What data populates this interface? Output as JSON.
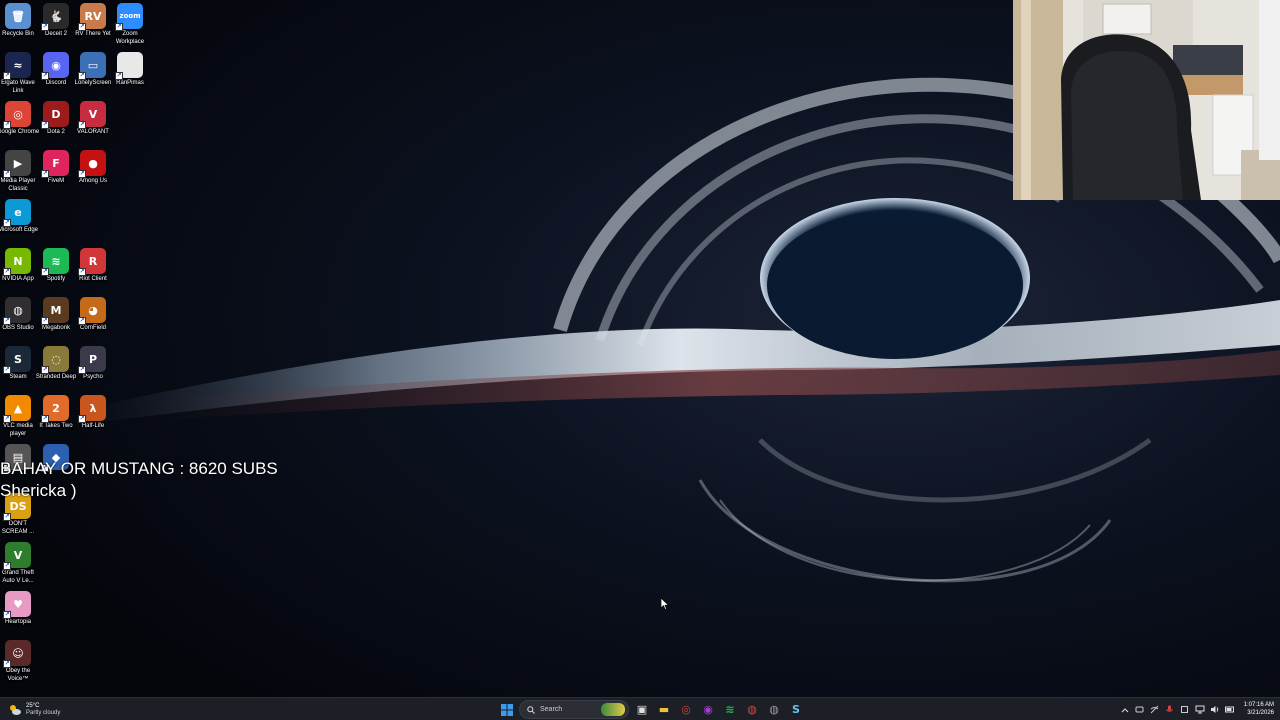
{
  "desktop": {
    "icons": [
      {
        "name": "recycle-bin-icon",
        "label": "Recycle Bin",
        "color": "#5a8fd0",
        "glyph": "🗑"
      },
      {
        "name": "deceit-2-icon",
        "label": "Deceit 2",
        "color": "#2a2a2a",
        "glyph": "🐇"
      },
      {
        "name": "rv-there-yet-icon",
        "label": "RV There Yet",
        "color": "#c97a4a",
        "glyph": "RV"
      },
      {
        "name": "zoom-icon",
        "label": "Zoom Workplace",
        "color": "#2d8cff",
        "glyph": "zoom"
      },
      {
        "name": "elgato-wave-link-icon",
        "label": "Elgato Wave Link",
        "color": "#1a2550",
        "glyph": "≈"
      },
      {
        "name": "discord-icon",
        "label": "Discord",
        "color": "#5865f2",
        "glyph": "◉"
      },
      {
        "name": "lonelyscreen-icon",
        "label": "LonelyScreen",
        "color": "#3b6fb6",
        "glyph": "▭"
      },
      {
        "name": "ranpimas-icon",
        "label": "RanPimas",
        "color": "#e8e8e8",
        "glyph": ""
      },
      {
        "name": "google-chrome-icon",
        "label": "Google Chrome",
        "color": "#db4437",
        "glyph": "◎"
      },
      {
        "name": "dota-2-icon",
        "label": "Dota 2",
        "color": "#9c1b1b",
        "glyph": "D"
      },
      {
        "name": "valorant-icon",
        "label": "VALORANT",
        "color": "#c72c41",
        "glyph": "V"
      },
      {
        "name": "media-player-classic-icon",
        "label": "Media Player Classic",
        "color": "#444",
        "glyph": "▶"
      },
      {
        "name": "fivem-icon",
        "label": "FiveM",
        "color": "#e0245e",
        "glyph": "F"
      },
      {
        "name": "among-us-icon",
        "label": "Among Us",
        "color": "#c51111",
        "glyph": "●"
      },
      {
        "name": "microsoft-edge-icon",
        "label": "Microsoft Edge",
        "color": "#0c9ad6",
        "glyph": "e"
      },
      {
        "name": "nvidia-app-icon",
        "label": "NVIDIA App",
        "color": "#76b900",
        "glyph": "N"
      },
      {
        "name": "spotify-icon",
        "label": "Spotify",
        "color": "#1db954",
        "glyph": "≋"
      },
      {
        "name": "riot-client-icon",
        "label": "Riot Client",
        "color": "#d13639",
        "glyph": "R"
      },
      {
        "name": "obs-studio-icon",
        "label": "OBS Studio",
        "color": "#302e31",
        "glyph": "◍"
      },
      {
        "name": "megabonk-icon",
        "label": "Megabonk",
        "color": "#5a3b20",
        "glyph": "M"
      },
      {
        "name": "cornfield-icon",
        "label": "CornField",
        "color": "#c46a1a",
        "glyph": "◕"
      },
      {
        "name": "steam-icon",
        "label": "Steam",
        "color": "#1b2838",
        "glyph": "S"
      },
      {
        "name": "stranded-deep-icon",
        "label": "Stranded Deep",
        "color": "#8a7a3a",
        "glyph": "◌"
      },
      {
        "name": "psycho-icon",
        "label": "Psycho",
        "color": "#3a3a4a",
        "glyph": "P"
      },
      {
        "name": "vlc-media-player-icon",
        "label": "VLC media player",
        "color": "#f28a00",
        "glyph": "▲"
      },
      {
        "name": "it-takes-two-icon",
        "label": "It Takes Two",
        "color": "#e06b2a",
        "glyph": "2"
      },
      {
        "name": "half-life-icon",
        "label": "Half-Life",
        "color": "#c8561d",
        "glyph": "λ"
      },
      {
        "name": "sharex-icon",
        "label": "",
        "color": "#555",
        "glyph": "▤"
      },
      {
        "name": "capture-app-icon",
        "label": "",
        "color": "#2d5fb0",
        "glyph": "◆"
      },
      {
        "name": "dont-scream-icon",
        "label": "DON'T SCREAM ...",
        "color": "#d9a012",
        "glyph": "DS"
      },
      {
        "name": "gta-v-icon",
        "label": "Grand Theft Auto V Le...",
        "color": "#2d7d2d",
        "glyph": "V"
      },
      {
        "name": "heartopia-icon",
        "label": "Heartopia",
        "color": "#e79ac4",
        "glyph": "♥"
      },
      {
        "name": "obey-the-voice-icon",
        "label": "Obey the Voice™",
        "color": "#5a2a2a",
        "glyph": "☺"
      }
    ]
  },
  "overlay": {
    "line1": "BAHAY OR MUSTANG : 8620 SUBS",
    "line2": "Shericka )"
  },
  "taskbar": {
    "weather": {
      "temp": "25°C",
      "condition": "Partly cloudy"
    },
    "search_placeholder": "Search",
    "clock": {
      "time": "1:07:16 AM",
      "date": "3/21/2026"
    },
    "pinned": [
      {
        "name": "task-view-icon",
        "glyph": "▣",
        "color": "#e0e0e0"
      },
      {
        "name": "file-explorer-icon",
        "glyph": "▬",
        "color": "#f0c23a"
      },
      {
        "name": "chrome-taskbar-icon",
        "glyph": "◎",
        "color": "#db4437"
      },
      {
        "name": "messenger-taskbar-icon",
        "glyph": "◉",
        "color": "#a33bd9"
      },
      {
        "name": "spotify-taskbar-icon",
        "glyph": "≋",
        "color": "#1db954"
      },
      {
        "name": "app-taskbar-icon",
        "glyph": "◍",
        "color": "#d24a3a"
      },
      {
        "name": "obs-taskbar-icon",
        "glyph": "◍",
        "color": "#9a9aa8"
      },
      {
        "name": "steam-taskbar-icon",
        "glyph": "S",
        "color": "#66c0f4"
      }
    ]
  }
}
